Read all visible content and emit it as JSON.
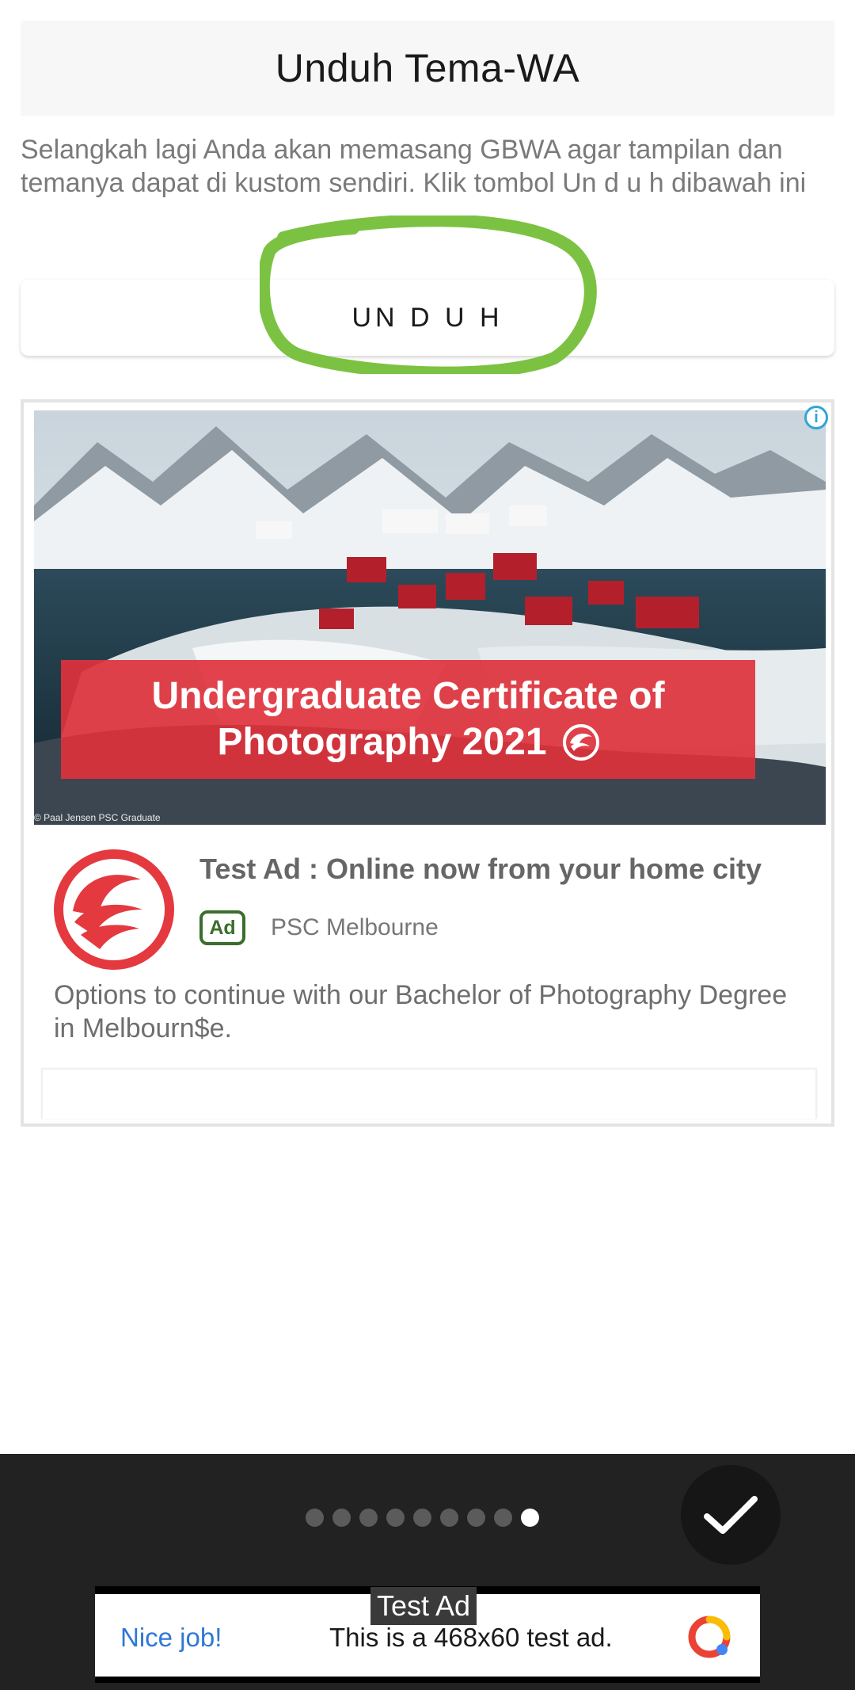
{
  "header": {
    "title": "Unduh Tema-WA"
  },
  "description": "Selangkah lagi Anda akan memasang GBWA agar tampilan dan temanya dapat di kustom sendiri. Klik tombol Un d u h dibawah ini",
  "download_button": {
    "label": "UN D U H"
  },
  "annotation": {
    "color": "#7cc242"
  },
  "native_ad": {
    "image_banner_line1": "Undergraduate Certificate of",
    "image_banner_line2": "Photography 2021",
    "image_caption": "© Paal Jensen PSC Graduate",
    "headline": "Test Ad : Online now from your home city",
    "badge": "Ad",
    "advertiser": "PSC Melbourne",
    "body": "Options to continue with our Bachelor of Photography Degree in Melbourn$e.",
    "info_icon": "info-icon",
    "brand_color": "#e4393f"
  },
  "pager": {
    "total": 9,
    "active_index": 8
  },
  "done_icon": "checkmark-icon",
  "banner_ad": {
    "label": "Test Ad",
    "nice_job": "Nice job!",
    "text": "This is a 468x60 test ad."
  }
}
